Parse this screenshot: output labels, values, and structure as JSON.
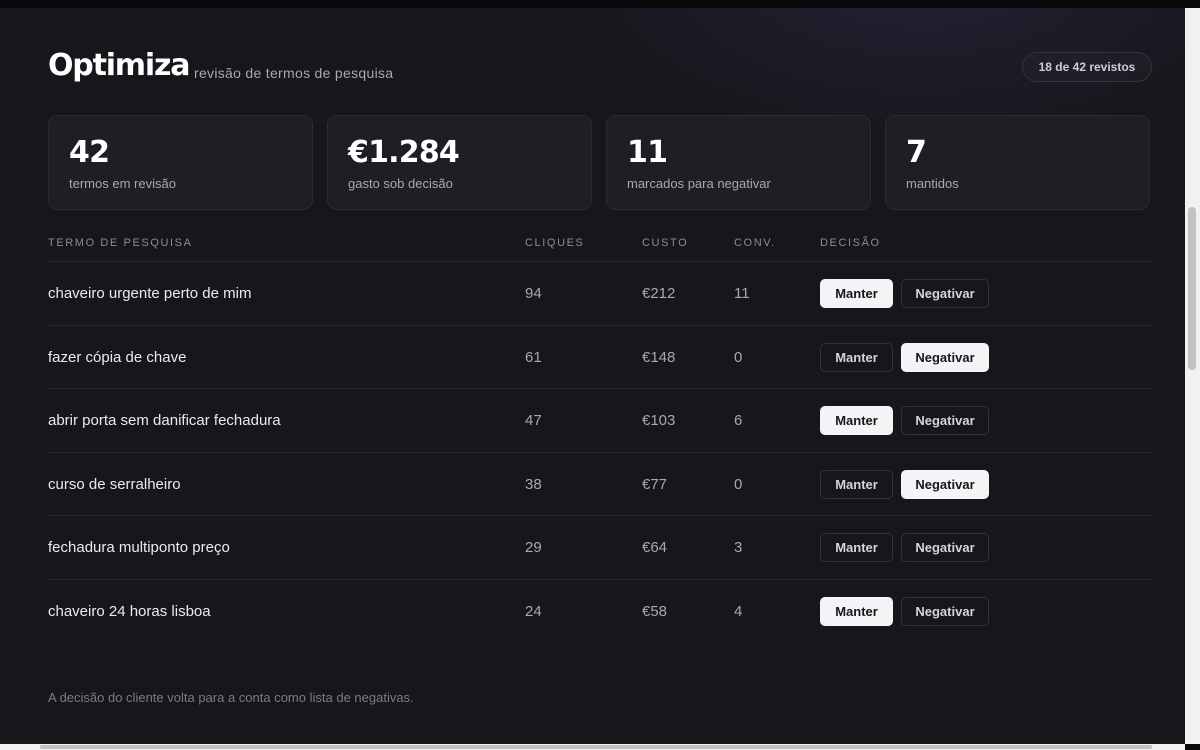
{
  "header": {
    "brand": "Optimiza",
    "subtitle": "revisão de termos de pesquisa",
    "progress": "18 de 42 revistos"
  },
  "stats": [
    {
      "value": "42",
      "label": "termos em revisão"
    },
    {
      "value": "€1.284",
      "label": "gasto sob decisão"
    },
    {
      "value": "11",
      "label": "marcados para negativar"
    },
    {
      "value": "7",
      "label": "mantidos"
    }
  ],
  "table": {
    "columns": {
      "term": "Termo de pesquisa",
      "clicks": "Cliques",
      "cost": "Custo",
      "conv": "Conv.",
      "decision": "Decisão"
    },
    "keep_label": "Manter",
    "negate_label": "Negativar",
    "rows": [
      {
        "term": "chaveiro urgente perto de mim",
        "clicks": "94",
        "cost": "€212",
        "conv": "11",
        "decision": "Manter"
      },
      {
        "term": "fazer cópia de chave",
        "clicks": "61",
        "cost": "€148",
        "conv": "0",
        "decision": "Negativar"
      },
      {
        "term": "abrir porta sem danificar fechadura",
        "clicks": "47",
        "cost": "€103",
        "conv": "6",
        "decision": "Manter"
      },
      {
        "term": "curso de serralheiro",
        "clicks": "38",
        "cost": "€77",
        "conv": "0",
        "decision": "Negativar"
      },
      {
        "term": "fechadura multiponto preço",
        "clicks": "29",
        "cost": "€64",
        "conv": "3",
        "decision": ""
      },
      {
        "term": "chaveiro 24 horas lisboa",
        "clicks": "24",
        "cost": "€58",
        "conv": "4",
        "decision": "Manter"
      }
    ]
  },
  "footnote": "A decisão do cliente volta para a conta como lista de negativas."
}
